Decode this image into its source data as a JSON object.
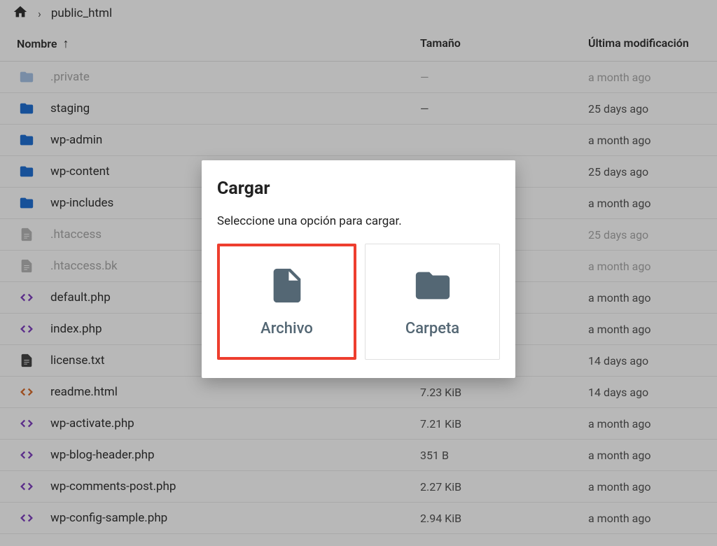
{
  "breadcrumb": {
    "path": "public_html"
  },
  "columns": {
    "name": "Nombre",
    "size": "Tamaño",
    "modified": "Última modificación"
  },
  "files": [
    {
      "name": ".private",
      "size": "—",
      "modified": "a month ago",
      "icon": "folder-muted",
      "muted": true
    },
    {
      "name": "staging",
      "size": "—",
      "modified": "25 days ago",
      "icon": "folder"
    },
    {
      "name": "wp-admin",
      "size": "",
      "modified": "a month ago",
      "icon": "folder"
    },
    {
      "name": "wp-content",
      "size": "",
      "modified": "25 days ago",
      "icon": "folder"
    },
    {
      "name": "wp-includes",
      "size": "",
      "modified": "a month ago",
      "icon": "folder"
    },
    {
      "name": ".htaccess",
      "size": "",
      "modified": "25 days ago",
      "icon": "file-muted",
      "muted": true
    },
    {
      "name": ".htaccess.bk",
      "size": "",
      "modified": "a month ago",
      "icon": "file-muted",
      "muted": true
    },
    {
      "name": "default.php",
      "size": "",
      "modified": "a month ago",
      "icon": "code"
    },
    {
      "name": "index.php",
      "size": "",
      "modified": "a month ago",
      "icon": "code"
    },
    {
      "name": "license.txt",
      "size": "",
      "modified": "14 days ago",
      "icon": "file-dark"
    },
    {
      "name": "readme.html",
      "size": "7.23 KiB",
      "modified": "14 days ago",
      "icon": "code-orange"
    },
    {
      "name": "wp-activate.php",
      "size": "7.21 KiB",
      "modified": "a month ago",
      "icon": "code"
    },
    {
      "name": "wp-blog-header.php",
      "size": "351 B",
      "modified": "a month ago",
      "icon": "code"
    },
    {
      "name": "wp-comments-post.php",
      "size": "2.27 KiB",
      "modified": "a month ago",
      "icon": "code"
    },
    {
      "name": "wp-config-sample.php",
      "size": "2.94 KiB",
      "modified": "a month ago",
      "icon": "code"
    }
  ],
  "modal": {
    "title": "Cargar",
    "subtitle": "Seleccione una opción para cargar.",
    "option_file": "Archivo",
    "option_folder": "Carpeta"
  }
}
